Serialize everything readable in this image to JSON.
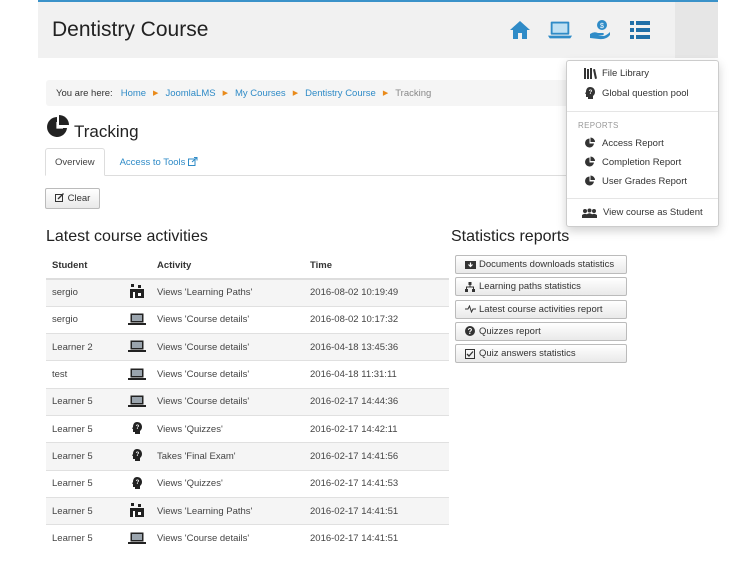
{
  "header": {
    "course_title": "Dentistry Course",
    "icons": [
      "home-icon",
      "laptop-icon",
      "hand-coin-icon",
      "list-icon"
    ],
    "accent_color": "#2f8bc7"
  },
  "breadcrumb": {
    "label": "You are here:",
    "items": [
      "Home",
      "JoomlaLMS",
      "My Courses",
      "Dentistry Course"
    ],
    "current": "Tracking"
  },
  "page": {
    "title": "Tracking",
    "tabs": [
      {
        "label": "Overview",
        "active": true
      },
      {
        "label": "Access to Tools",
        "active": false
      }
    ],
    "clear_label": "Clear"
  },
  "activities": {
    "heading": "Latest course activities",
    "columns": [
      "Student",
      "",
      "Activity",
      "Time"
    ],
    "rows": [
      {
        "student": "sergio",
        "icon": "learning-path-icon",
        "activity": "Views 'Learning Paths'",
        "time": "2016-08-02 10:19:49"
      },
      {
        "student": "sergio",
        "icon": "laptop-icon",
        "activity": "Views 'Course details'",
        "time": "2016-08-02 10:17:32"
      },
      {
        "student": "Learner 2",
        "icon": "laptop-icon",
        "activity": "Views 'Course details'",
        "time": "2016-04-18 13:45:36"
      },
      {
        "student": "test",
        "icon": "laptop-icon",
        "activity": "Views 'Course details'",
        "time": "2016-04-18 11:31:11"
      },
      {
        "student": "Learner 5",
        "icon": "laptop-icon",
        "activity": "Views 'Course details'",
        "time": "2016-02-17 14:44:36"
      },
      {
        "student": "Learner 5",
        "icon": "quiz-head-icon",
        "activity": "Views 'Quizzes'",
        "time": "2016-02-17 14:42:11"
      },
      {
        "student": "Learner 5",
        "icon": "quiz-head-icon",
        "activity": "Takes 'Final Exam'",
        "time": "2016-02-17 14:41:56"
      },
      {
        "student": "Learner 5",
        "icon": "quiz-head-icon",
        "activity": "Views 'Quizzes'",
        "time": "2016-02-17 14:41:53"
      },
      {
        "student": "Learner 5",
        "icon": "learning-path-icon",
        "activity": "Views 'Learning Paths'",
        "time": "2016-02-17 14:41:51"
      },
      {
        "student": "Learner 5",
        "icon": "laptop-icon",
        "activity": "Views 'Course details'",
        "time": "2016-02-17 14:41:51"
      }
    ]
  },
  "statistics": {
    "heading": "Statistics reports",
    "buttons": [
      {
        "label": "Documents downloads statistics",
        "icon": "download-icon"
      },
      {
        "label": "Learning paths statistics",
        "icon": "sitemap-icon"
      },
      {
        "label": "Latest course activities report",
        "icon": "pulse-icon"
      },
      {
        "label": "Quizzes report",
        "icon": "question-icon"
      },
      {
        "label": "Quiz answers statistics",
        "icon": "checkbox-icon"
      }
    ]
  },
  "dropdown": {
    "items_top": [
      {
        "label": "File Library",
        "icon": "books-icon"
      },
      {
        "label": "Global question pool",
        "icon": "quiz-head-icon"
      }
    ],
    "reports_header": "REPORTS",
    "reports": [
      {
        "label": "Access Report",
        "icon": "pie-chart-icon"
      },
      {
        "label": "Completion Report",
        "icon": "pie-chart-icon"
      },
      {
        "label": "User Grades Report",
        "icon": "pie-chart-icon"
      }
    ],
    "bottom_item": {
      "label": "View course as Student",
      "icon": "students-icon"
    }
  }
}
